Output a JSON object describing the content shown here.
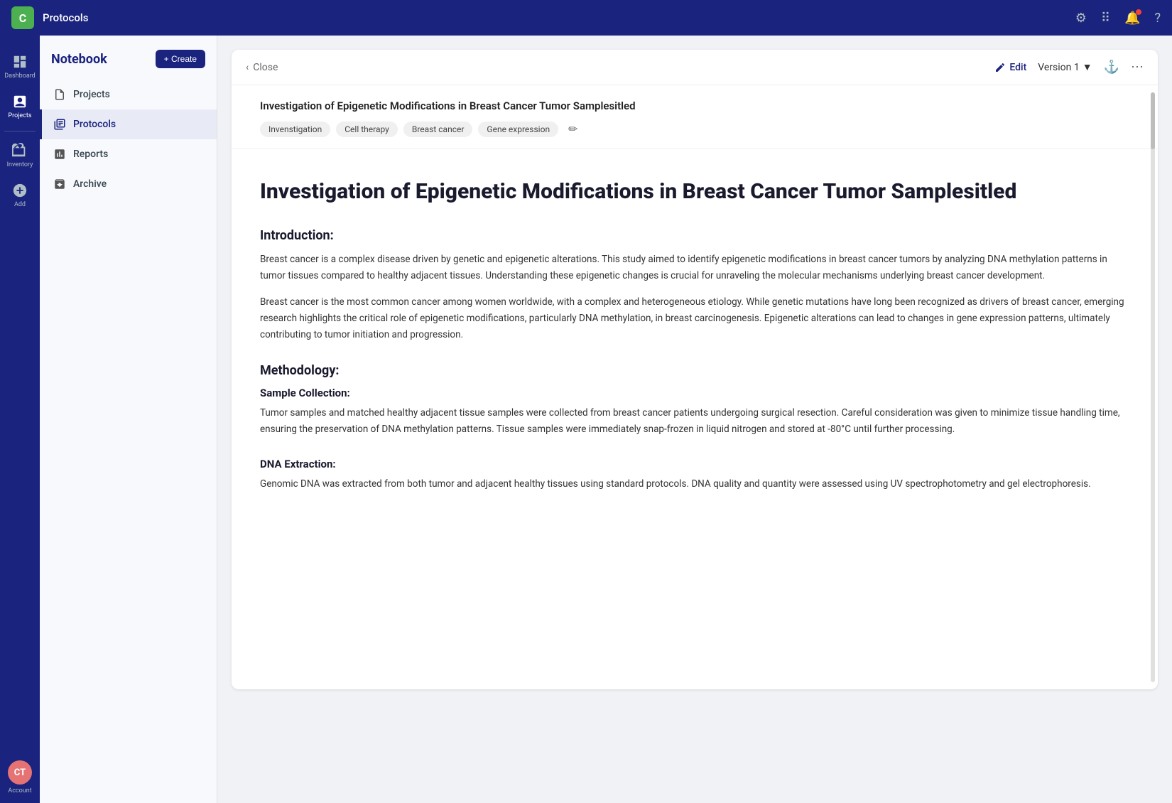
{
  "topbar": {
    "logo": "C",
    "title": "Protocols",
    "icons": [
      "gear",
      "grid",
      "notification",
      "help"
    ]
  },
  "sidebar": {
    "items": [
      {
        "id": "dashboard",
        "label": "Dashboard",
        "active": false
      },
      {
        "id": "projects",
        "label": "Projects",
        "active": true
      },
      {
        "id": "inventory",
        "label": "Inventory",
        "active": false
      },
      {
        "id": "add",
        "label": "Add",
        "active": false
      }
    ],
    "account": {
      "label": "Account",
      "initials": "CT"
    }
  },
  "notebook": {
    "title": "Notebook",
    "create_label": "+ Create",
    "nav_items": [
      {
        "id": "projects",
        "label": "Projects",
        "active": false
      },
      {
        "id": "protocols",
        "label": "Protocols",
        "active": true
      },
      {
        "id": "reports",
        "label": "Reports",
        "active": false
      },
      {
        "id": "archive",
        "label": "Archive",
        "active": false
      }
    ]
  },
  "document": {
    "toolbar": {
      "close_label": "Close",
      "edit_label": "Edit",
      "version_label": "Version 1"
    },
    "header_title": "Investigation of Epigenetic Modifications in Breast Cancer Tumor Samplesitled",
    "tags": [
      "Invenstigation",
      "Cell therapy",
      "Breast cancer",
      "Gene expression"
    ],
    "main_title": "Investigation of Epigenetic Modifications in Breast Cancer Tumor Samplesitled",
    "sections": [
      {
        "id": "introduction",
        "title": "Introduction:",
        "paragraphs": [
          "Breast cancer is a complex disease driven by genetic and epigenetic alterations. This study aimed to identify epigenetic modifications in breast cancer tumors by analyzing DNA methylation patterns in tumor tissues compared to healthy adjacent tissues. Understanding these epigenetic changes is crucial for unraveling the molecular mechanisms underlying breast cancer development.",
          "Breast cancer is the most common cancer among women worldwide, with a complex and heterogeneous etiology. While genetic mutations have long been recognized as drivers of breast cancer, emerging research highlights the critical role of epigenetic modifications, particularly DNA methylation, in breast carcinogenesis. Epigenetic alterations can lead to changes in gene expression patterns, ultimately contributing to tumor initiation and progression."
        ],
        "subsections": []
      },
      {
        "id": "methodology",
        "title": "Methodology:",
        "paragraphs": [],
        "subsections": [
          {
            "id": "sample-collection",
            "title": "Sample Collection:",
            "paragraphs": [
              "Tumor samples and matched healthy adjacent tissue samples were collected from breast cancer patients undergoing surgical resection. Careful consideration was given to minimize tissue handling time, ensuring the preservation of DNA methylation patterns. Tissue samples were immediately snap-frozen in liquid nitrogen and stored at -80°C until further processing."
            ]
          },
          {
            "id": "dna-extraction",
            "title": "DNA Extraction:",
            "paragraphs": [
              "Genomic DNA was extracted from both tumor and adjacent healthy tissues using standard protocols. DNA quality and quantity were assessed using UV spectrophotometry and gel electrophoresis."
            ]
          }
        ]
      }
    ]
  }
}
